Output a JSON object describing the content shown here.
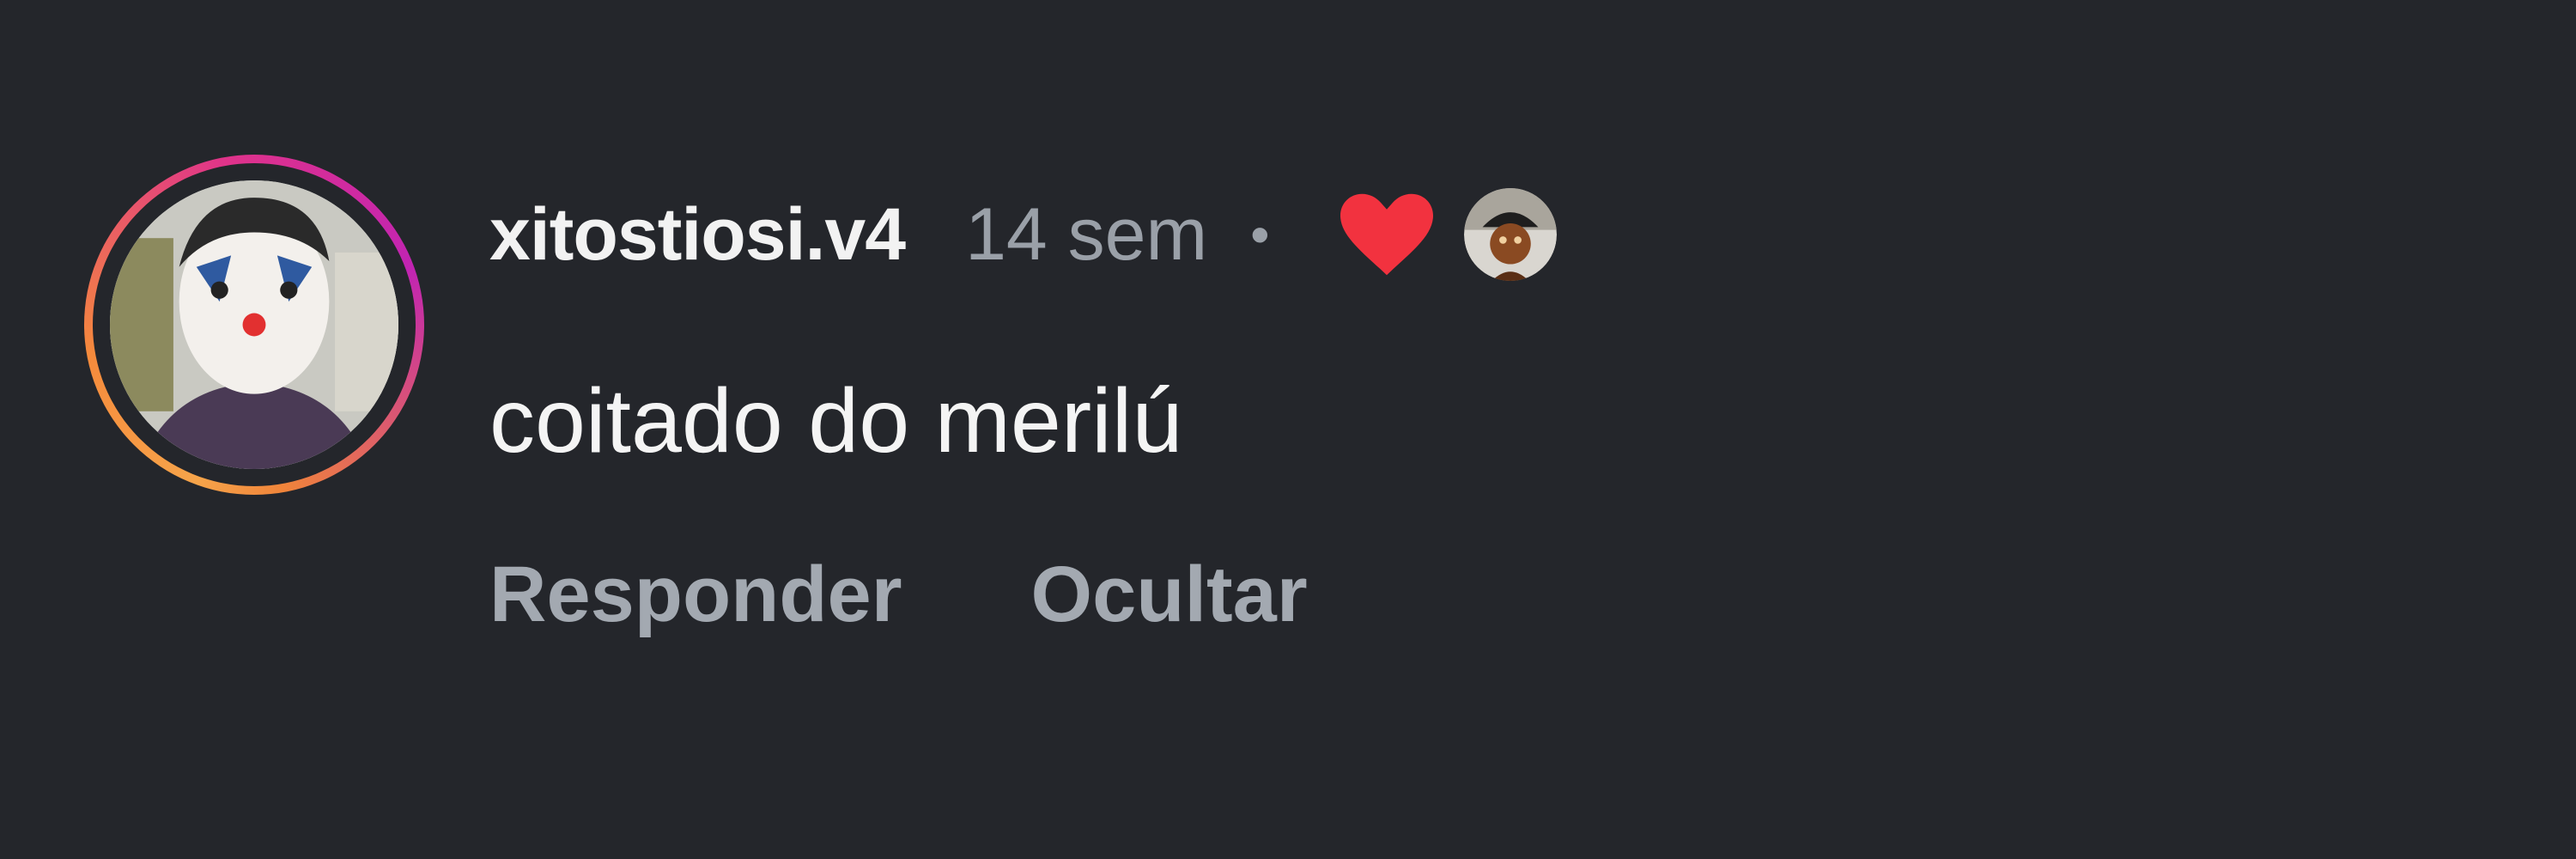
{
  "comment": {
    "username": "xitostiosi.v4",
    "timestamp": "14 sem",
    "separator": "•",
    "text": "coitado do merilú",
    "liked_by_author": true,
    "heart_color": "#f2323f",
    "avatar_icon": "user-avatar",
    "liker_avatar_icon": "liker-avatar"
  },
  "actions": {
    "reply_label": "Responder",
    "hide_label": "Ocultar"
  },
  "colors": {
    "background": "#24262b",
    "username": "#f2f2f2",
    "muted": "#9aa0a8"
  }
}
